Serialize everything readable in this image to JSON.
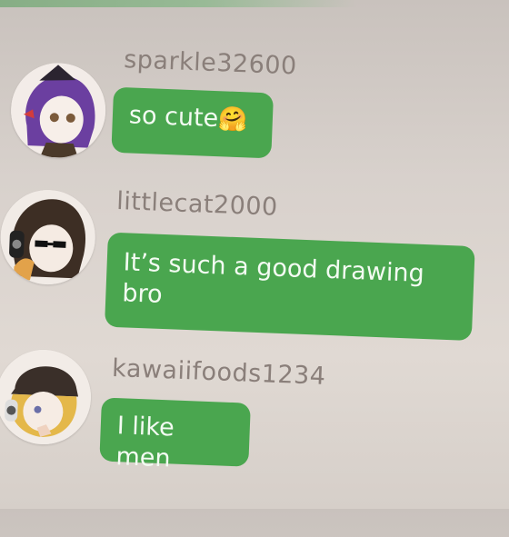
{
  "messages": [
    {
      "username": "sparkle32600",
      "text": "so cute",
      "emoji": "🤗",
      "avatar_icon": "purple-hair-character-avatar"
    },
    {
      "username": "littlecat2000",
      "text": "It’s such a good drawing bro",
      "emoji": "",
      "avatar_icon": "headphones-character-avatar"
    },
    {
      "username": "kawaiifoods1234",
      "text": "I like men",
      "emoji": "",
      "avatar_icon": "blonde-beanie-character-avatar"
    }
  ],
  "colors": {
    "bubble": "#4aa64f",
    "bubble_text": "#f3fbf2",
    "username": "#8a7f7a",
    "background": "#d8d1cc"
  }
}
